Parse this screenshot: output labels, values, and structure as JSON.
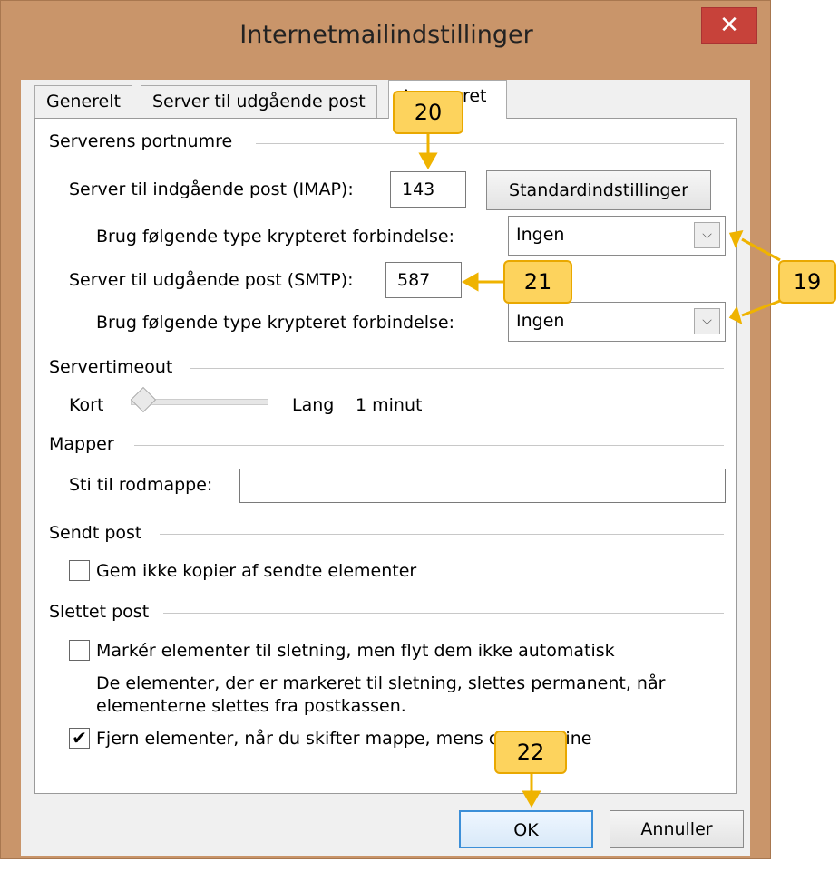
{
  "window": {
    "title": "Internetmailindstillinger",
    "close_label": "✕"
  },
  "tabs": [
    {
      "label": "Generelt"
    },
    {
      "label": "Server til udgående post"
    },
    {
      "label": "Avanceret"
    }
  ],
  "ports": {
    "group_label": "Serverens portnumre",
    "imap_label": "Server til indgående post (IMAP):",
    "imap_value": "143",
    "default_button": "Standardindstillinger",
    "imap_encryption_label": "Brug følgende type krypteret forbindelse:",
    "imap_encryption_value": "Ingen",
    "smtp_label": "Server til udgående post (SMTP):",
    "smtp_value": "587",
    "smtp_encryption_label": "Brug følgende type krypteret forbindelse:",
    "smtp_encryption_value": "Ingen"
  },
  "timeout": {
    "group_label": "Servertimeout",
    "short_label": "Kort",
    "long_label": "Lang",
    "value_text": "1 minut",
    "slider_level": 0
  },
  "folders": {
    "group_label": "Mapper",
    "root_label": "Sti til rodmappe:",
    "root_value": ""
  },
  "sent": {
    "group_label": "Sendt post",
    "dont_save_label": "Gem ikke kopier af sendte elementer",
    "dont_save_checked": false
  },
  "deleted": {
    "group_label": "Slettet post",
    "mark_label": "Markér elementer til sletning, men flyt dem ikke automatisk",
    "mark_checked": false,
    "info_line1": "De elementer, der er markeret til sletning, slettes permanent, når",
    "info_line2": "elementerne slettes fra postkassen.",
    "purge_label": "Fjern elementer, når du skifter mappe, mens du er online",
    "purge_checked": true
  },
  "buttons": {
    "ok": "OK",
    "cancel": "Annuller"
  },
  "callouts": {
    "c19": "19",
    "c20": "20",
    "c21": "21",
    "c22": "22"
  },
  "colors": {
    "window_frame": "#c9956a",
    "close_button": "#c7423a",
    "callout_fill": "#fdd35d",
    "callout_border": "#e9a800"
  }
}
